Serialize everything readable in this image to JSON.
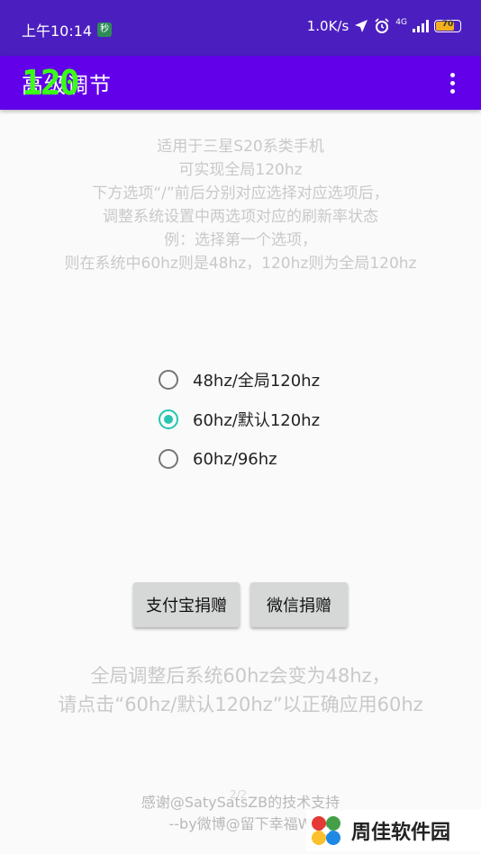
{
  "status_bar": {
    "time": "上午10:14",
    "network_speed": "1.0K/s",
    "network_type": "4G",
    "battery": "70",
    "mini_icon_text": "秒"
  },
  "app_bar": {
    "title": "高级调节",
    "badge": "120"
  },
  "description": {
    "lines": [
      "适用于三星S20系类手机",
      "可实现全局120hz",
      "下方选项“/”前后分别对应选择对应选项后，",
      "调整系统设置中两选项对应的刷新率状态",
      "例：选择第一个选项，",
      "则在系统中60hz则是48hz，120hz则为全局120hz"
    ]
  },
  "refresh_options": [
    {
      "label": "48hz/全局120hz",
      "checked": false
    },
    {
      "label": "60hz/默认120hz",
      "checked": true
    },
    {
      "label": "60hz/96hz",
      "checked": false
    }
  ],
  "buttons": {
    "alipay": "支付宝捐赠",
    "wechat": "微信捐赠"
  },
  "notice": {
    "lines": [
      "全局调整后系统60hz会变为48hz，",
      "请点击“60hz/默认120hz”以正确应用60hz"
    ]
  },
  "credits": {
    "page_indicator": "2/2",
    "lines": [
      "感谢@SatySatsZB的技术支持",
      "--by微博@留下幸福W"
    ]
  },
  "watermark": {
    "text": "周佳软件园"
  },
  "colors": {
    "status_bar": "#4b1fbf",
    "app_bar": "#6200ea",
    "accent": "#26c6b0",
    "button_bg": "#d6d7d7",
    "hint_text": "#c9c9c9",
    "badge": "#39ff14"
  }
}
